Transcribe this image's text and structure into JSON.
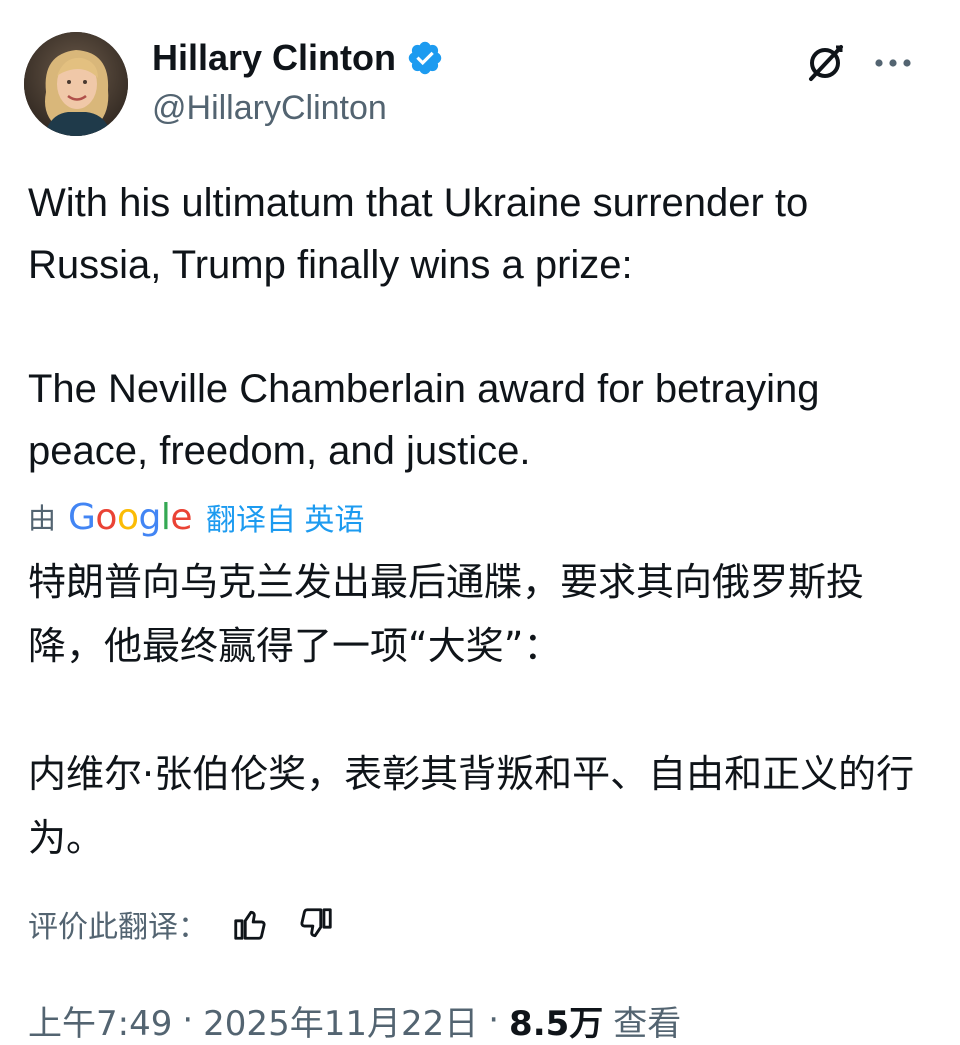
{
  "author": {
    "display_name": "Hillary Clinton",
    "handle": "@HillaryClinton",
    "verified": true,
    "verified_color": "#1d9bf0"
  },
  "header": {
    "grok_icon": "grok-icon",
    "more_icon": "more-horizontal-icon"
  },
  "tweet": {
    "paragraphs": [
      "With his ultimatum that Ukraine surrender to Russia, Trump finally wins a prize:",
      "The Neville Chamberlain award for betraying peace, freedom, and justice."
    ]
  },
  "translation": {
    "by_prefix": "由",
    "provider_logo": "Google",
    "from_label": "翻译自 英语",
    "paragraphs": [
      "特朗普向乌克兰发出最后通牒，要求其向俄罗斯投降，他最终赢得了一项“大奖”：",
      "内维尔·张伯伦奖，表彰其背叛和平、自由和正义的行为。"
    ],
    "rate_label": "评价此翻译："
  },
  "meta": {
    "time": "上午7:49",
    "separator": "·",
    "date": "2025年11月22日",
    "views_count": "8.5万",
    "views_label": "查看"
  },
  "colors": {
    "text_primary": "#0f1419",
    "text_secondary": "#536471",
    "link": "#1d9bf0"
  }
}
